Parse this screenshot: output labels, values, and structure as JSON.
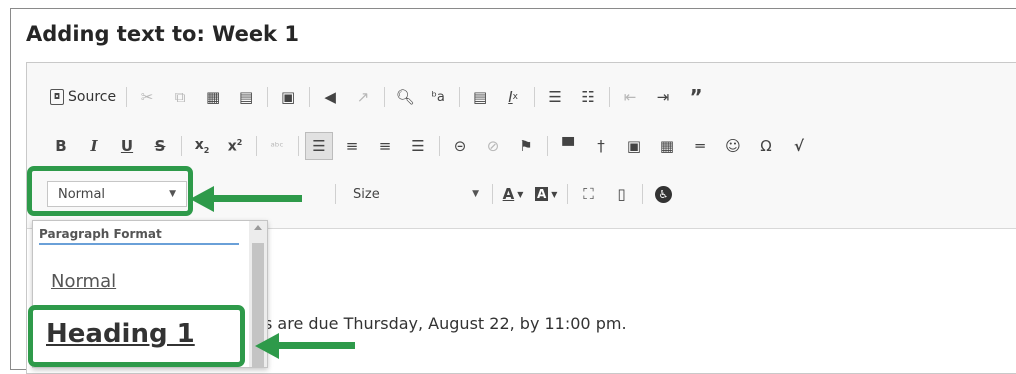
{
  "window": {
    "title": "Adding text to: Week 1"
  },
  "toolbar": {
    "source_label": "Source",
    "row1_icons": [
      "cut-icon",
      "copy-icon",
      "paste-icon",
      "paste-text-icon",
      "paste-word-icon",
      "undo-icon",
      "redo-icon",
      "find-icon",
      "replace-icon",
      "spellcheck-icon",
      "remove-format-icon",
      "numbered-list-icon",
      "bulleted-list-icon",
      "outdent-icon",
      "indent-icon",
      "blockquote-icon"
    ],
    "row2_icons": [
      "bold-icon",
      "italic-icon",
      "underline-icon",
      "strikethrough-icon",
      "subscript-icon",
      "superscript-icon",
      "spell-icon",
      "align-left-icon",
      "align-center-icon",
      "align-right-icon",
      "justify-icon",
      "link-icon",
      "unlink-icon",
      "anchor-icon",
      "cart-icon",
      "insert-tool-icon",
      "image-icon",
      "table-icon",
      "horizontal-line-icon",
      "smiley-icon",
      "special-char-icon",
      "math-icon"
    ],
    "format_combo": {
      "value": "Normal"
    },
    "size_combo": {
      "value": "Size"
    },
    "text_color_label": "A",
    "bg_color_label": "A"
  },
  "dropdown": {
    "header": "Paragraph Format",
    "options": [
      "Normal",
      "Heading 1"
    ]
  },
  "content": {
    "text": "s are due Thursday, August 22, by 11:00 pm."
  },
  "colors": {
    "callout": "#2e9a4a",
    "panel_underline": "#6aa0d8"
  }
}
